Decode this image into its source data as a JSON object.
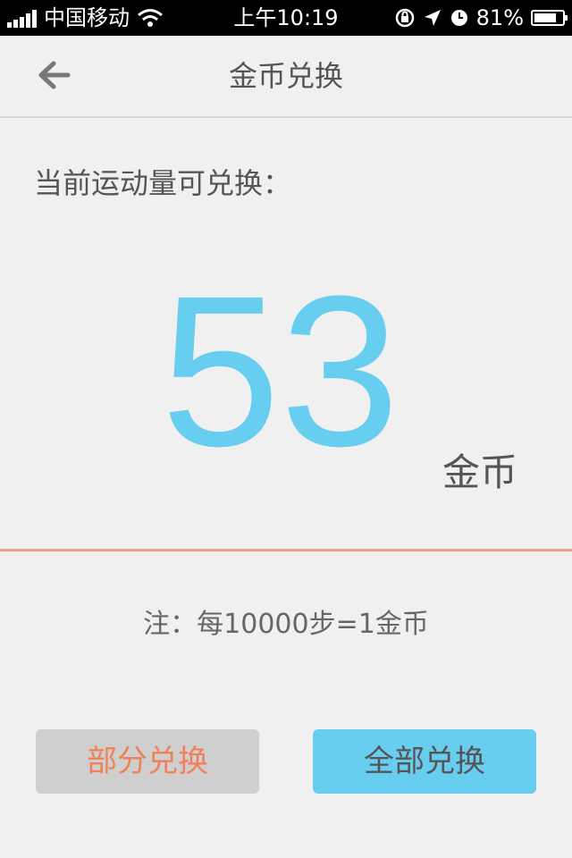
{
  "statusbar": {
    "carrier": "中国移动",
    "time": "上午10:19",
    "battery_percent": "81%",
    "battery_level": 0.81,
    "icons": [
      "signal-icon",
      "wifi-icon",
      "rotation-lock-icon",
      "location-icon",
      "alarm-icon",
      "battery-icon"
    ]
  },
  "navbar": {
    "title": "金币兑换",
    "back_icon": "arrow-left-icon"
  },
  "main": {
    "label": "当前运动量可兑换：",
    "amount": "53",
    "unit": "金币",
    "note": "注：每10000步=1金币"
  },
  "buttons": {
    "partial": "部分兑换",
    "all": "全部兑换"
  },
  "colors": {
    "accent_blue": "#67cef0",
    "accent_orange": "#f08158",
    "divider": "#f0a088",
    "background": "#f0f0f0"
  }
}
